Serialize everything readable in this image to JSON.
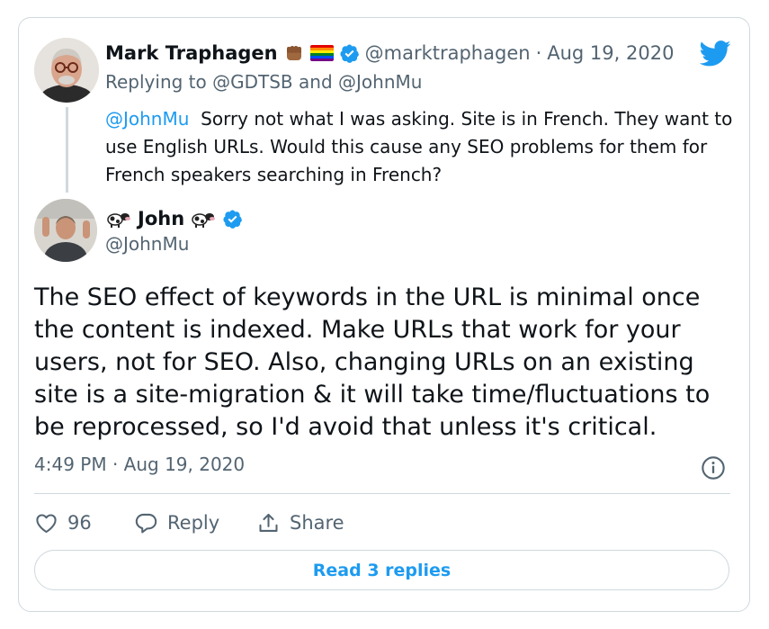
{
  "parent_tweet": {
    "author_name": "Mark Traphagen",
    "handle": "@marktraphagen",
    "separator": "·",
    "date": "Aug 19, 2020",
    "replying_to_prefix": "Replying to",
    "replying_to_1": "@GDTSB",
    "replying_to_and": "and",
    "replying_to_2": "@JohnMu",
    "mention": "@JohnMu",
    "text": "Sorry not what I was asking. Site is in French. They want to use English URLs. Would this cause any SEO problems for them for French speakers searching in French?"
  },
  "main_tweet": {
    "author_name": "John",
    "handle": "@JohnMu",
    "text": "The SEO effect of keywords in the URL is minimal once the content is indexed. Make URLs that work for your users, not for SEO. Also, changing URLs on an existing site is a site-migration & it will take time/fluctuations to be reprocessed, so I'd avoid that unless it's critical.",
    "timestamp": "4:49 PM · Aug 19, 2020"
  },
  "actions": {
    "like_count": "96",
    "reply_label": "Reply",
    "share_label": "Share"
  },
  "read_replies_label": "Read 3 replies",
  "icons": {
    "brand": "twitter-bird-icon",
    "verified": "verified-badge-icon",
    "like": "heart-icon",
    "reply": "speech-bubble-icon",
    "share": "share-upload-icon",
    "info": "info-circle-icon"
  },
  "colors": {
    "accent": "#1d9bf0",
    "text": "#0f1419",
    "muted": "#536471",
    "border": "#cfd9de"
  }
}
